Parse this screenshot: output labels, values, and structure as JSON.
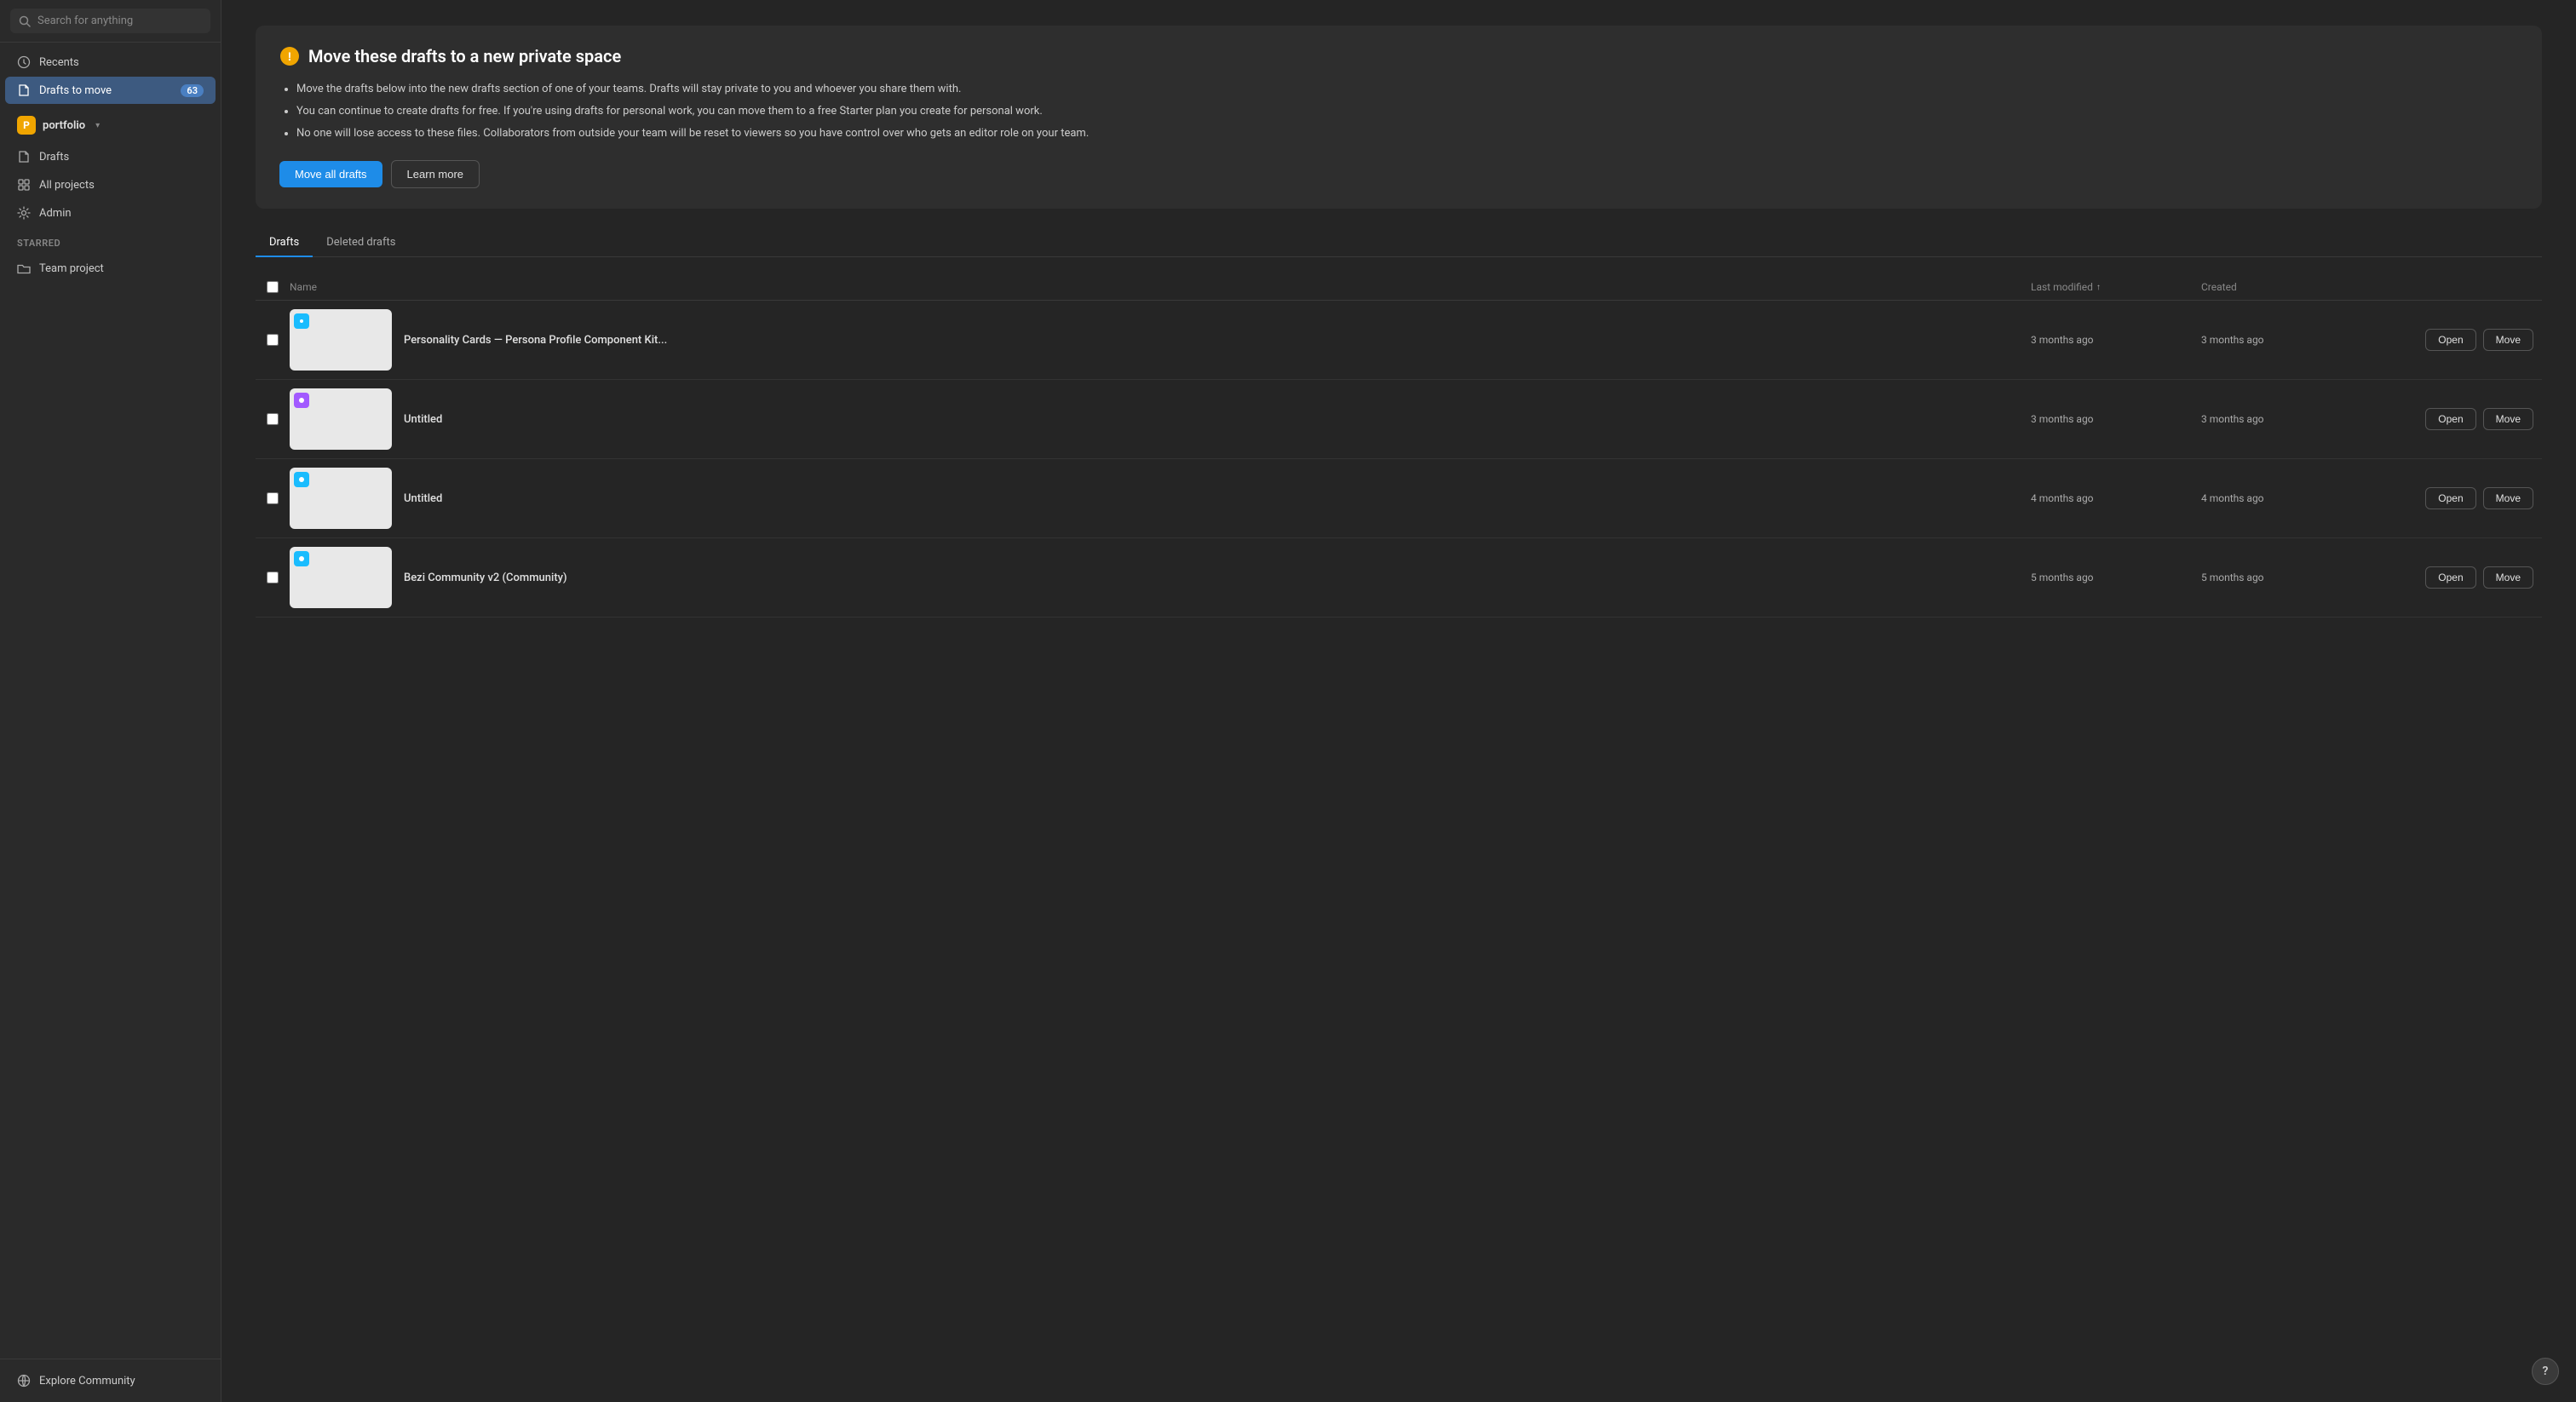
{
  "sidebar": {
    "search_placeholder": "Search for anything",
    "nav_items": [
      {
        "id": "recents",
        "label": "Recents",
        "icon": "clock",
        "active": false
      },
      {
        "id": "drafts-to-move",
        "label": "Drafts to move",
        "icon": "file",
        "active": true,
        "badge": "63"
      }
    ],
    "workspace": {
      "avatar_letter": "P",
      "name": "portfolio",
      "chevron": "▾"
    },
    "workspace_nav": [
      {
        "id": "drafts",
        "label": "Drafts",
        "icon": "file"
      },
      {
        "id": "all-projects",
        "label": "All projects",
        "icon": "grid"
      },
      {
        "id": "admin",
        "label": "Admin",
        "icon": "settings"
      }
    ],
    "starred_label": "Starred",
    "starred_items": [
      {
        "id": "team-project",
        "label": "Team project",
        "icon": "folder"
      }
    ],
    "bottom_items": [
      {
        "id": "explore-community",
        "label": "Explore Community",
        "icon": "globe"
      }
    ]
  },
  "main": {
    "alert": {
      "title": "Move these drafts to a new private space",
      "bullets": [
        "Move the drafts below into the new drafts section of one of your teams. Drafts will stay private to you and whoever you share them with.",
        "You can continue to create drafts for free. If you're using drafts for personal work, you can move them to a free Starter plan you create for personal work.",
        "No one will lose access to these files. Collaborators from outside your team will be reset to viewers so you have control over who gets an editor role on your team."
      ],
      "btn_move_all": "Move all drafts",
      "btn_learn_more": "Learn more"
    },
    "tabs": [
      {
        "id": "drafts",
        "label": "Drafts",
        "active": true
      },
      {
        "id": "deleted-drafts",
        "label": "Deleted drafts",
        "active": false
      }
    ],
    "table": {
      "columns": {
        "name": "Name",
        "last_modified": "Last modified",
        "created": "Created",
        "sort_arrow": "↑"
      },
      "rows": [
        {
          "id": "row-1",
          "name": "Personality Cards — Persona Profile Component Kit...",
          "last_modified": "3 months ago",
          "created": "3 months ago",
          "icon_color": "blue",
          "btn_open": "Open",
          "btn_move": "Move"
        },
        {
          "id": "row-2",
          "name": "Untitled",
          "last_modified": "3 months ago",
          "created": "3 months ago",
          "icon_color": "purple",
          "btn_open": "Open",
          "btn_move": "Move"
        },
        {
          "id": "row-3",
          "name": "Untitled",
          "last_modified": "4 months ago",
          "created": "4 months ago",
          "icon_color": "blue",
          "btn_open": "Open",
          "btn_move": "Move"
        },
        {
          "id": "row-4",
          "name": "Bezi Community v2 (Community)",
          "last_modified": "5 months ago",
          "created": "5 months ago",
          "icon_color": "blue",
          "btn_open": "Open",
          "btn_move": "Move"
        }
      ]
    }
  },
  "help_btn_label": "?"
}
